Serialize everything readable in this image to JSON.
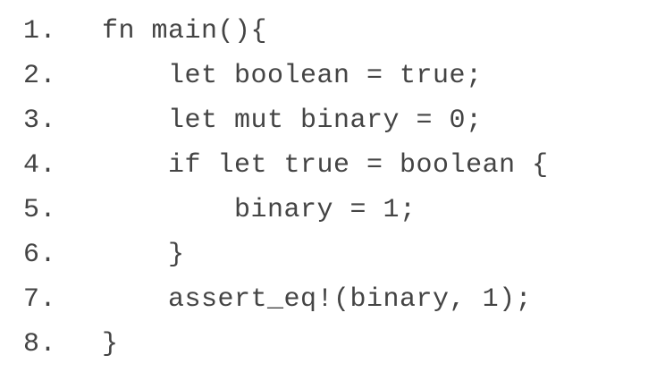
{
  "code": {
    "lines": [
      {
        "number": "1.",
        "text": "fn main(){"
      },
      {
        "number": "2.",
        "text": "    let boolean = true;"
      },
      {
        "number": "3.",
        "text": "    let mut binary = 0;"
      },
      {
        "number": "4.",
        "text": "    if let true = boolean {"
      },
      {
        "number": "5.",
        "text": "        binary = 1;"
      },
      {
        "number": "6.",
        "text": "    }"
      },
      {
        "number": "7.",
        "text": "    assert_eq!(binary, 1);"
      },
      {
        "number": "8.",
        "text": "}"
      }
    ]
  }
}
